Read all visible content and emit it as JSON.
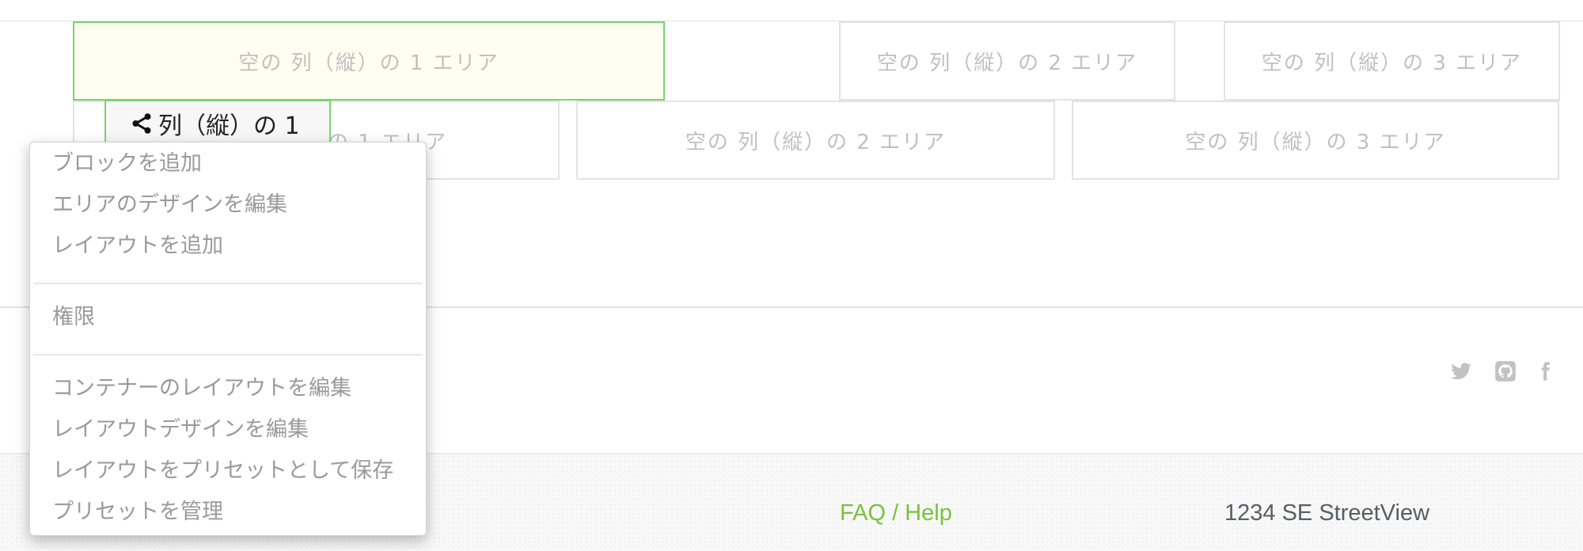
{
  "row1": {
    "area1": "空の 列（縦）の 1 エリア",
    "area2": "空の 列（縦）の 2 エリア",
    "area3": "空の 列（縦）の 3 エリア"
  },
  "row2": {
    "area1": "の 1 エリア",
    "area2": "空の 列（縦）の 2 エリア",
    "area3": "空の 列（縦）の 3 エリア"
  },
  "column_handle": {
    "label": "列（縦）の 1",
    "icon": "share-icon"
  },
  "context_menu": {
    "add_block": "ブロックを追加",
    "edit_area_design": "エリアのデザインを編集",
    "add_layout": "レイアウトを追加",
    "permissions": "権限",
    "edit_container_layout": "コンテナーのレイアウトを編集",
    "edit_layout_design": "レイアウトデザインを編集",
    "save_layout_preset": "レイアウトをプリセットとして保存",
    "manage_presets": "プリセットを管理"
  },
  "social": {
    "icons": [
      "twitter-icon",
      "github-icon",
      "facebook-icon"
    ]
  },
  "footer": {
    "faq_link": "FAQ / Help",
    "address": "1234 SE StreetView"
  },
  "colors": {
    "active_border": "#7ad372",
    "active_bg": "#fffdef",
    "link_green": "#77c43a"
  }
}
